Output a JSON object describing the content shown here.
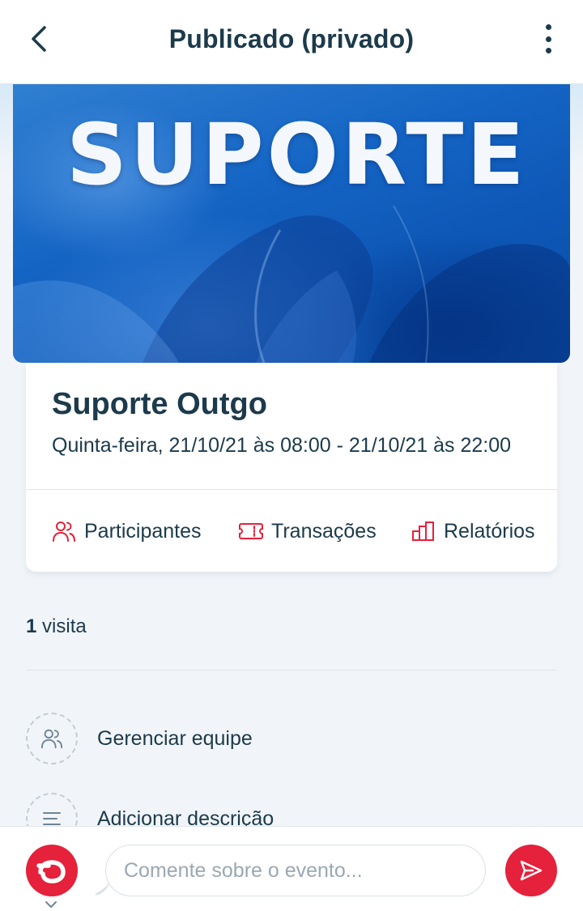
{
  "header": {
    "title": "Publicado (privado)",
    "back_icon": "chevron-left-icon",
    "more_icon": "more-vertical-icon"
  },
  "cover": {
    "logo_text": "SUPORTE"
  },
  "event": {
    "title": "Suporte Outgo",
    "date": "Quinta-feira, 21/10/21 às 08:00 - 21/10/21 às 22:00"
  },
  "actions": [
    {
      "label": "Participantes",
      "icon": "users-icon"
    },
    {
      "label": "Transações",
      "icon": "ticket-icon"
    },
    {
      "label": "Relatórios",
      "icon": "bar-chart-icon"
    }
  ],
  "visits": {
    "count": "1",
    "label": "visita"
  },
  "options": [
    {
      "label": "Gerenciar equipe",
      "icon": "users-icon"
    },
    {
      "label": "Adicionar descrição",
      "icon": "text-lines-icon"
    }
  ],
  "comment": {
    "placeholder": "Comente sobre o evento..."
  },
  "colors": {
    "accent": "#e5213b",
    "text": "#1c3a4b",
    "background": "#f1f5f9"
  }
}
